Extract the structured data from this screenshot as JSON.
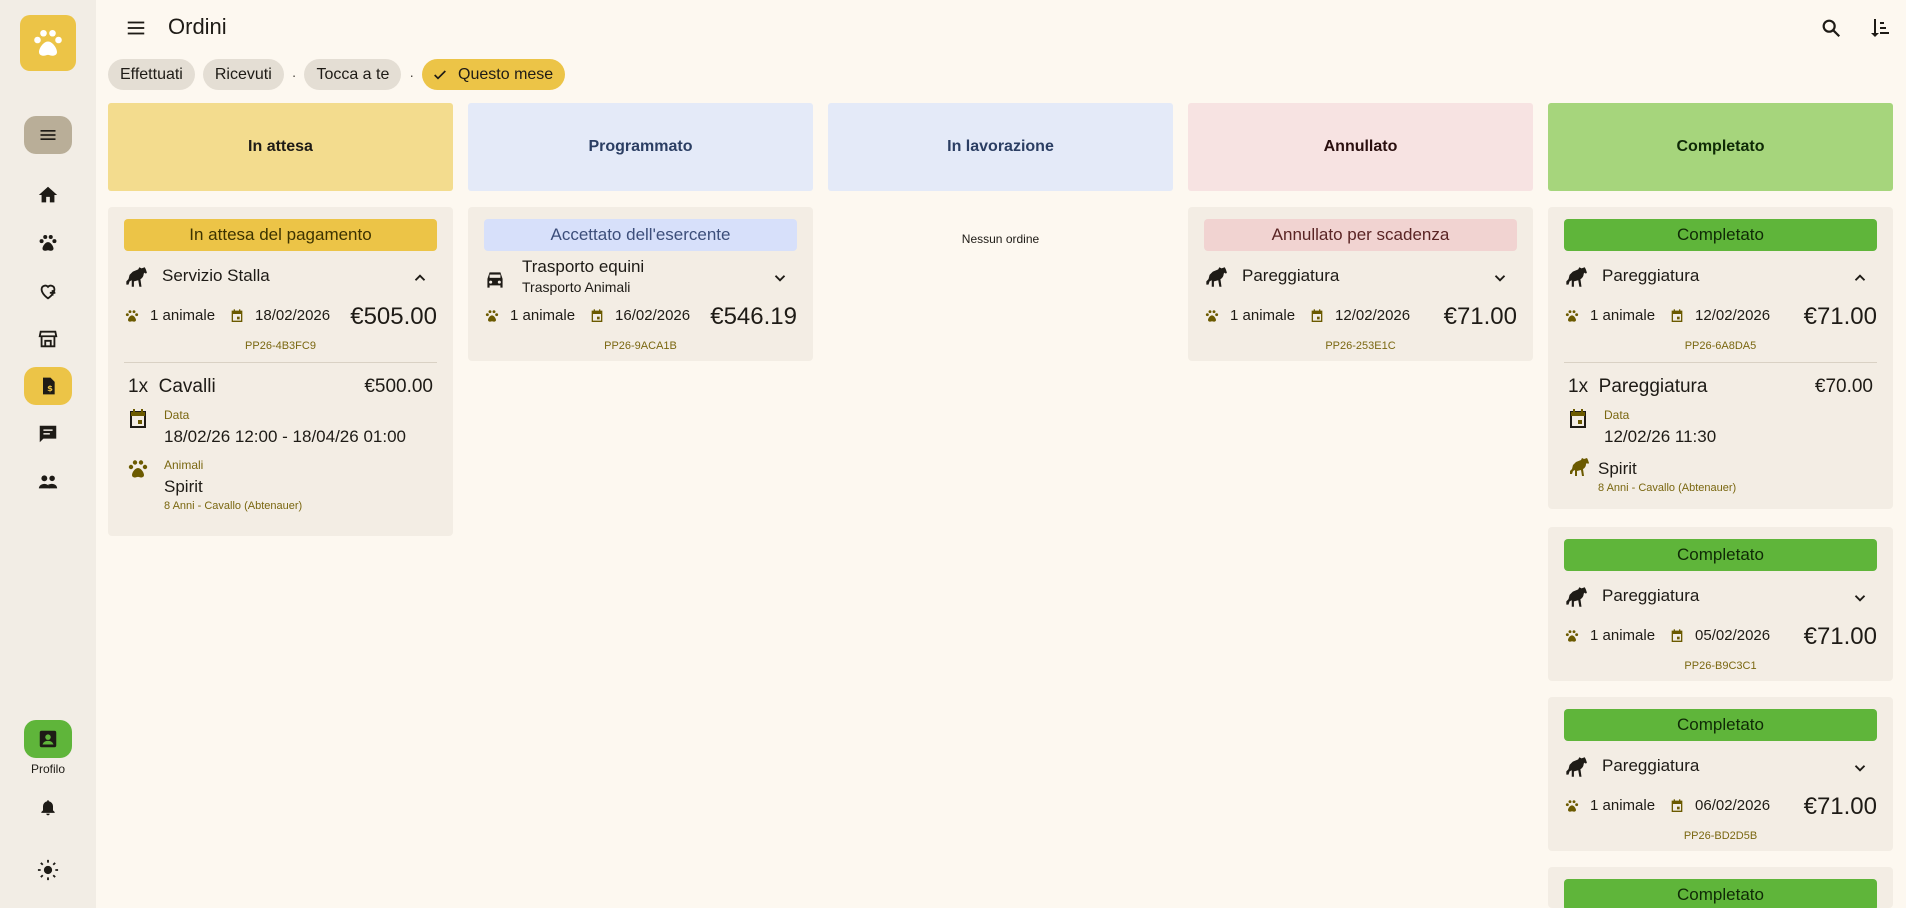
{
  "header": {
    "title": "Ordini"
  },
  "filters": {
    "chips": [
      "Effettuati",
      "Ricevuti",
      "Tocca a te",
      "Questo mese"
    ],
    "separator": "·"
  },
  "rail": {
    "items": [
      "menu-icon",
      "home-icon",
      "paw-icon",
      "healing-icon",
      "store-icon",
      "invoice-icon",
      "chat-icon",
      "people-icon"
    ],
    "profile_label": "Profilo"
  },
  "columns": [
    {
      "title": "In attesa",
      "color": "#f3dc8e"
    },
    {
      "title": "Programmato",
      "color": "#e4eaf8"
    },
    {
      "title": "In lavorazione",
      "color": "#e4eaf8"
    },
    {
      "title": "Annullato",
      "color": "#f7e3e2"
    },
    {
      "title": "Completato",
      "color": "#a6d57c"
    }
  ],
  "empty_text": "Nessun ordine",
  "orders": {
    "pending": {
      "status": "In attesa del pagamento",
      "title": "Servizio Stalla",
      "animals": "1 animale",
      "date": "18/02/2026",
      "price": "€505.00",
      "code": "PP26-4B3FC9",
      "line_qty": "1x",
      "line_name": "Cavalli",
      "line_price": "€500.00",
      "date_label": "Data",
      "date_value": "18/02/26 12:00 - 18/04/26 01:00",
      "animals_label": "Animali",
      "animal_name": "Spirit",
      "animal_desc": "8 Anni - Cavallo (Abtenauer)"
    },
    "scheduled": {
      "status": "Accettato dell'esercente",
      "title": "Trasporto equini",
      "subtitle": "Trasporto Animali",
      "animals": "1 animale",
      "date": "16/02/2026",
      "price": "€546.19",
      "code": "PP26-9ACA1B"
    },
    "cancelled": {
      "status": "Annullato per scadenza",
      "title": "Pareggiatura",
      "animals": "1 animale",
      "date": "12/02/2026",
      "price": "€71.00",
      "code": "PP26-253E1C"
    },
    "completed": [
      {
        "status": "Completato",
        "title": "Pareggiatura",
        "animals": "1 animale",
        "date": "12/02/2026",
        "price": "€71.00",
        "code": "PP26-6A8DA5",
        "line_qty": "1x",
        "line_name": "Pareggiatura",
        "line_price": "€70.00",
        "date_label": "Data",
        "date_value": "12/02/26 11:30",
        "animal_name": "Spirit",
        "animal_desc": "8 Anni - Cavallo (Abtenauer)"
      },
      {
        "status": "Completato",
        "title": "Pareggiatura",
        "animals": "1 animale",
        "date": "05/02/2026",
        "price": "€71.00",
        "code": "PP26-B9C3C1"
      },
      {
        "status": "Completato",
        "title": "Pareggiatura",
        "animals": "1 animale",
        "date": "06/02/2026",
        "price": "€71.00",
        "code": "PP26-BD2D5B"
      },
      {
        "status": "Completato"
      }
    ]
  },
  "colors": {
    "accent": "#ecc447",
    "success": "#5fb53a",
    "pending_status": "#ecc447",
    "scheduled_status": "#d7e0fa",
    "cancelled_status": "#f1d3d1"
  }
}
